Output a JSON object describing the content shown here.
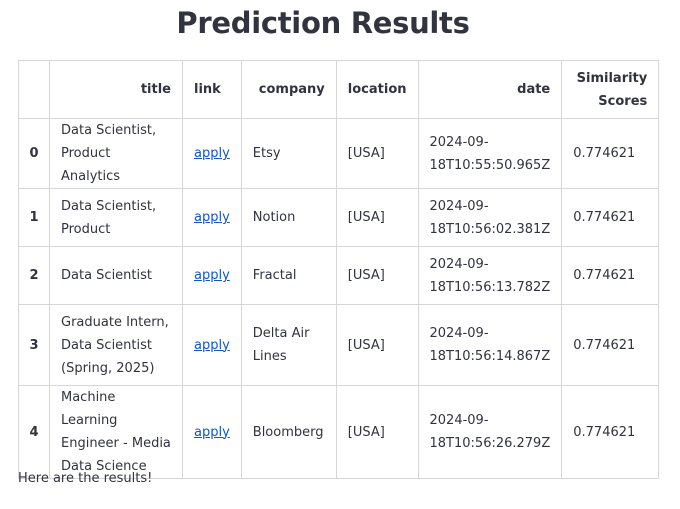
{
  "page": {
    "title": "Prediction Results",
    "footer_text": "Here are the results!"
  },
  "table": {
    "headers": {
      "index": "",
      "title": "title",
      "link": "link",
      "company": "company",
      "location": "location",
      "date": "date",
      "similarity_line1": "Similarity",
      "similarity_line2": "Scores"
    },
    "rows": [
      {
        "index": "0",
        "title_lines": [
          "Data Scientist,",
          "Product Analytics"
        ],
        "link": "apply",
        "company_lines": [
          "Etsy"
        ],
        "location": "[USA]",
        "date_lines": [
          "2024-09-",
          "18T10:55:50.965Z"
        ],
        "score": "0.774621"
      },
      {
        "index": "1",
        "title_lines": [
          "Data Scientist,",
          "Product"
        ],
        "link": "apply",
        "company_lines": [
          "Notion"
        ],
        "location": "[USA]",
        "date_lines": [
          "2024-09-",
          "18T10:56:02.381Z"
        ],
        "score": "0.774621"
      },
      {
        "index": "2",
        "title_lines": [
          "Data Scientist"
        ],
        "link": "apply",
        "company_lines": [
          "Fractal"
        ],
        "location": "[USA]",
        "date_lines": [
          "2024-09-",
          "18T10:56:13.782Z"
        ],
        "score": "0.774621"
      },
      {
        "index": "3",
        "title_lines": [
          "Graduate Intern,",
          "Data Scientist",
          "(Spring, 2025)"
        ],
        "link": "apply",
        "company_lines": [
          "Delta Air",
          "Lines"
        ],
        "location": "[USA]",
        "date_lines": [
          "2024-09-",
          "18T10:56:14.867Z"
        ],
        "score": "0.774621"
      },
      {
        "index": "4",
        "title_lines": [
          "Machine Learning",
          "Engineer - Media",
          "Data Science"
        ],
        "link": "apply",
        "company_lines": [
          "Bloomberg"
        ],
        "location": "[USA]",
        "date_lines": [
          "2024-09-",
          "18T10:56:26.279Z"
        ],
        "score": "0.774621"
      }
    ]
  },
  "colors": {
    "text": "#31333f",
    "link": "#0b57d0",
    "border": "#d6d6d9"
  }
}
